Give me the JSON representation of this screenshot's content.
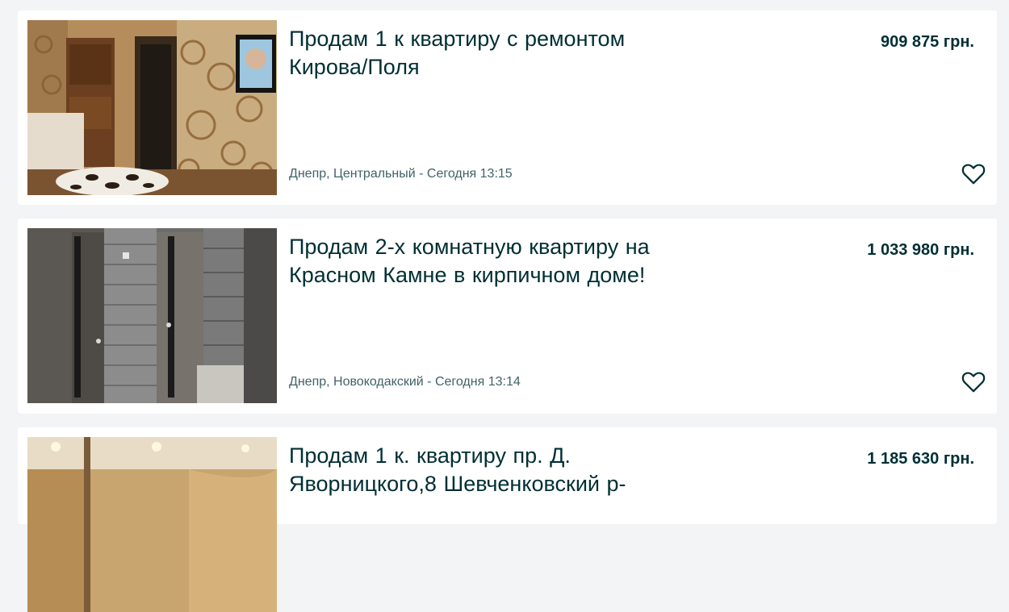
{
  "listings": [
    {
      "title": "Продам 1 к квартиру с ремонтом Кирова/Поля",
      "price": "909 875 грн.",
      "location": "Днепр, Центральный",
      "separator": " - ",
      "date": "Сегодня 13:15",
      "favorite_icon": "heart-outline-icon",
      "image_subject": "room-with-patterned-wallpaper"
    },
    {
      "title": "Продам 2-х комнатную квартиру на Красном Камне в кирпичном доме!",
      "price": "1 033 980 грн.",
      "location": "Днепр, Новокодакский",
      "separator": " - ",
      "date": "Сегодня 13:14",
      "favorite_icon": "heart-outline-icon",
      "image_subject": "hallway-with-doors-and-brick-wall"
    },
    {
      "title": "Продам 1 к. квартиру пр. Д. Яворницкого,8 Шевченковский р-",
      "price": "1 185 630 грн.",
      "image_subject": "room-with-ceiling-spotlights"
    }
  ],
  "colors": {
    "page_bg": "#f2f4f5",
    "card_bg": "#ffffff",
    "text_primary": "#002f34",
    "text_secondary": "#406367"
  }
}
